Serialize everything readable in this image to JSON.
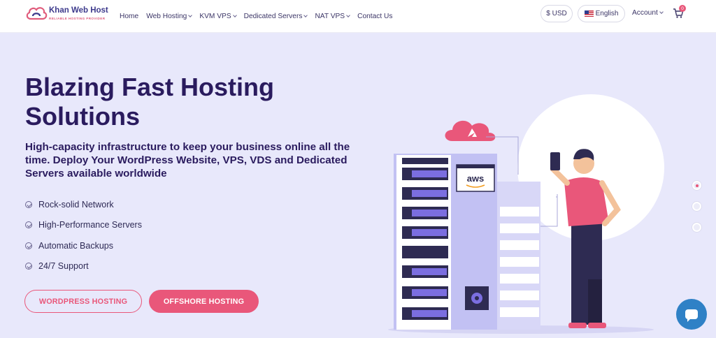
{
  "brand": {
    "name": "Khan Web Host",
    "tagline": "RELIABLE HOSTING PROVIDER"
  },
  "nav": {
    "items": [
      {
        "label": "Home",
        "dropdown": false
      },
      {
        "label": "Web Hosting",
        "dropdown": true
      },
      {
        "label": "KVM VPS",
        "dropdown": true
      },
      {
        "label": "Dedicated Servers",
        "dropdown": true
      },
      {
        "label": "NAT VPS",
        "dropdown": true
      },
      {
        "label": "Contact Us",
        "dropdown": false
      }
    ],
    "currency": "$ USD",
    "language": "English",
    "account": "Account",
    "cart_count": "0"
  },
  "hero": {
    "title": "Blazing Fast Hosting Solutions",
    "subtitle": "High-capacity infrastructure to keep your business online all the time. Deploy Your WordPress Website, VPS, VDS and Dedicated Servers available worldwide",
    "features": [
      "Rock-solid Network",
      "High-Performance Servers",
      "Automatic Backups",
      "24/7 Support"
    ],
    "buttons": {
      "primary_outline": "WORDPRESS HOSTING",
      "primary_fill": "OFFSHORE HOSTING"
    }
  },
  "illustration": {
    "server_label": "aws"
  },
  "colors": {
    "accent": "#e9577a",
    "navy": "#2a1b5e",
    "hero_bg": "#e8e8fb",
    "chat": "#2f81c6",
    "server": "#b8b7f2"
  },
  "slider": {
    "count": 3,
    "active": 0
  }
}
